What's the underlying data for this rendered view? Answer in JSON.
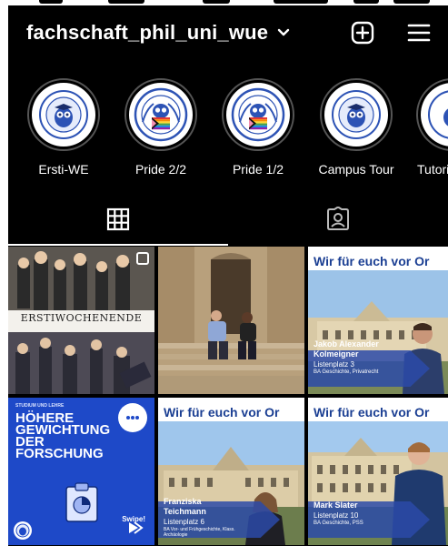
{
  "header": {
    "username": "fachschaft_phil_uni_wue"
  },
  "highlights": [
    {
      "label": "Ersti-WE"
    },
    {
      "label": "Pride 2/2"
    },
    {
      "label": "Pride 1/2"
    },
    {
      "label": "Campus Tour"
    },
    {
      "label": "Tutori"
    }
  ],
  "posts": {
    "p1": {
      "caption": "ERSTIWOCHENENDE"
    },
    "p3": {
      "title": "Wir für euch vor Or",
      "name": "Jakob Alexander Kolmeigner",
      "sub1": "Listenplatz 3",
      "sub2": "BA Geschichte, Privatrecht"
    },
    "p4": {
      "small": "STUDIUM UND LEHRE",
      "big": "HÖHERE GEWICHTUNG DER FORSCHUNG",
      "swipe": "Swipe!"
    },
    "p5": {
      "title": "Wir für euch vor Or",
      "name": "Franziska Teichmann",
      "sub1": "Listenplatz 6",
      "sub2": "BA Vor- und Frühgeschichte, Klass. Archäologie"
    },
    "p6": {
      "title": "Wir für euch vor Or",
      "name": "Mark Slater",
      "sub1": "Listenplatz 10",
      "sub2": "BA Geschichte, PSS"
    }
  },
  "colors": {
    "background": "#000000",
    "text": "#ffffff",
    "brandBlue": "#1b3f93",
    "postBlue": "#1e49c8"
  }
}
